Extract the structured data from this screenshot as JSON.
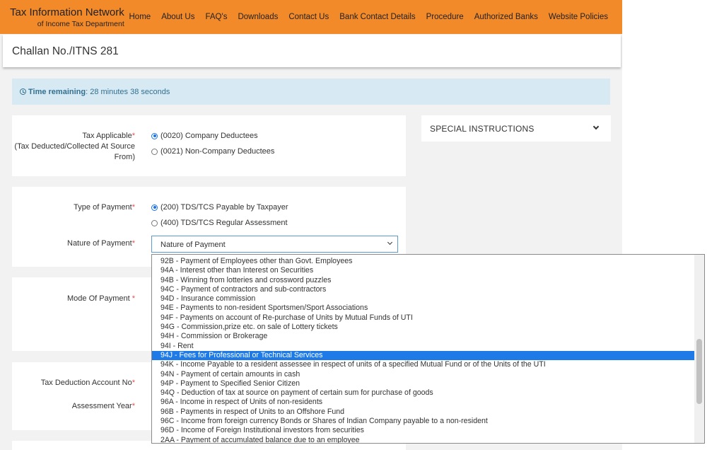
{
  "header": {
    "logo_title": "Tax Information Network",
    "logo_sub": "of Income Tax Department",
    "nav": [
      "Home",
      "About Us",
      "FAQ's",
      "Downloads",
      "Contact Us",
      "Bank Contact Details",
      "Procedure",
      "Authorized Banks",
      "Website Policies"
    ],
    "accent_color": "#f28a2a"
  },
  "page_title": "Challan No./ITNS 281",
  "timer": {
    "label": "Time remaining",
    "value": ": 28 minutes 38 seconds",
    "icon": "clock-icon"
  },
  "tax_applicable": {
    "label": "Tax Applicable",
    "label2": "(Tax Deducted/Collected At Source",
    "label3": "From)",
    "options": [
      "(0020) Company Deductees",
      "(0021) Non-Company Deductees"
    ],
    "selected_index": 0
  },
  "type_of_payment": {
    "label": "Type of Payment",
    "options": [
      "(200) TDS/TCS Payable by Taxpayer",
      "(400) TDS/TCS Regular Assessment"
    ],
    "selected_index": 0
  },
  "nature_of_payment": {
    "label": "Nature of Payment",
    "selected_value": "Nature of Payment",
    "options": [
      "92B - Payment of Employees other than Govt. Employees",
      "94A - Interest other than Interest on Securities",
      "94B - Winning from lotteries and crossword puzzles",
      "94C - Payment of contractors and sub-contractors",
      "94D - Insurance commission",
      "94E - Payments to non-resident Sportsmen/Sport Associations",
      "94F - Payments on account of Re-purchase of Units by Mutual Funds of UTI",
      "94G - Commission,prize etc. on sale of Lottery tickets",
      "94H - Commission or Brokerage",
      "94I - Rent",
      "94J - Fees for Professional or Technical Services",
      "94K - Income Payable to a resident assessee in respect of units of a specified Mutual Fund or of the Units of the UTI",
      "94N - Payment of certain amounts in cash",
      "94P - Payment to Specified Senior Citizen",
      "94Q - Deduction of tax at source on payment of certain sum for purchase of goods",
      "96A - Income in respect of Units of non-residents",
      "96B - Payments in respect of Units to an Offshore Fund",
      "96C - Income from foreign currency Bonds or Shares of Indian Company payable to a non-resident",
      "96D - Income of Foreign Institutional investors from securities",
      "2AA - Payment of accumulated balance due to an employee"
    ],
    "highlighted_index": 10
  },
  "mode_of_payment": {
    "label": "Mode Of Payment"
  },
  "tan": {
    "label": "Tax Deduction Account No"
  },
  "assessment_year": {
    "label": "Assessment Year"
  },
  "special_instructions": {
    "label": "SPECIAL INSTRUCTIONS",
    "icon": "chevron-down-icon"
  }
}
